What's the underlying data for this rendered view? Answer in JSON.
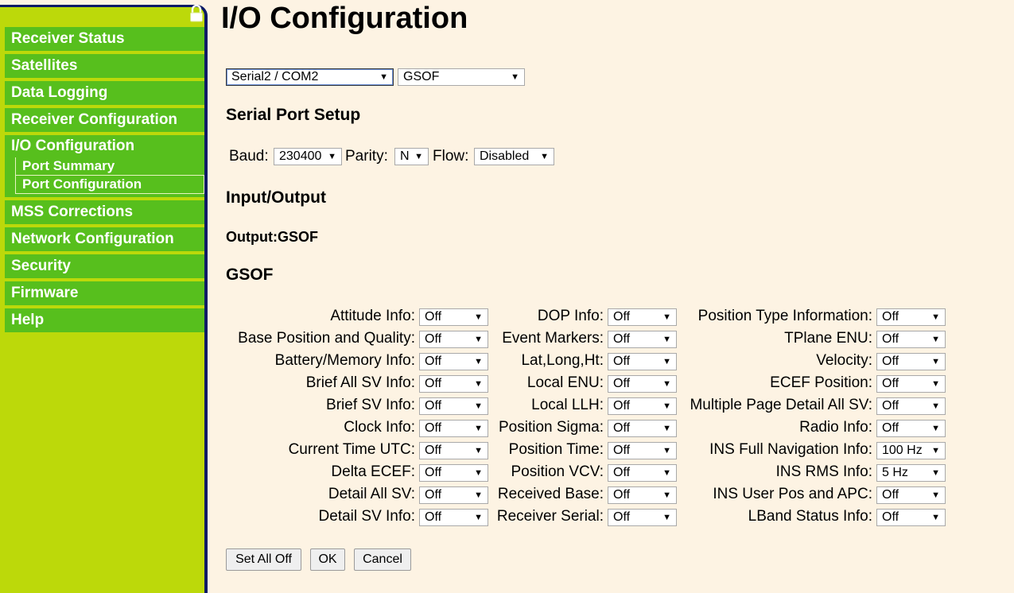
{
  "sidebar": {
    "items": [
      {
        "label": "Receiver Status"
      },
      {
        "label": "Satellites"
      },
      {
        "label": "Data Logging"
      },
      {
        "label": "Receiver Configuration"
      },
      {
        "label": "I/O Configuration",
        "sub": [
          "Port Summary",
          "Port Configuration"
        ]
      },
      {
        "label": "MSS Corrections"
      },
      {
        "label": "Network Configuration"
      },
      {
        "label": "Security"
      },
      {
        "label": "Firmware"
      },
      {
        "label": "Help"
      }
    ]
  },
  "page": {
    "title": "I/O Configuration",
    "port_select": "Serial2 / COM2",
    "protocol_select": "GSOF",
    "serial_heading": "Serial Port Setup",
    "baud_label": "Baud:",
    "baud_value": "230400",
    "parity_label": "Parity:",
    "parity_value": "N",
    "flow_label": "Flow:",
    "flow_value": "Disabled",
    "io_heading": "Input/Output",
    "output_label": "Output:GSOF",
    "gsof_heading": "GSOF",
    "buttons": {
      "set_all_off": "Set All Off",
      "ok": "OK",
      "cancel": "Cancel"
    }
  },
  "gsof": {
    "col1": [
      {
        "label": "Attitude Info:",
        "value": "Off"
      },
      {
        "label": "Base Position and Quality:",
        "value": "Off"
      },
      {
        "label": "Battery/Memory Info:",
        "value": "Off"
      },
      {
        "label": "Brief All SV Info:",
        "value": "Off"
      },
      {
        "label": "Brief SV Info:",
        "value": "Off"
      },
      {
        "label": "Clock Info:",
        "value": "Off"
      },
      {
        "label": "Current Time UTC:",
        "value": "Off"
      },
      {
        "label": "Delta ECEF:",
        "value": "Off"
      },
      {
        "label": "Detail All SV:",
        "value": "Off"
      },
      {
        "label": "Detail SV Info:",
        "value": "Off"
      }
    ],
    "col2": [
      {
        "label": "DOP Info:",
        "value": "Off"
      },
      {
        "label": "Event Markers:",
        "value": "Off"
      },
      {
        "label": "Lat,Long,Ht:",
        "value": "Off"
      },
      {
        "label": "Local ENU:",
        "value": "Off"
      },
      {
        "label": "Local LLH:",
        "value": "Off"
      },
      {
        "label": "Position Sigma:",
        "value": "Off"
      },
      {
        "label": "Position Time:",
        "value": "Off"
      },
      {
        "label": "Position VCV:",
        "value": "Off"
      },
      {
        "label": "Received Base:",
        "value": "Off"
      },
      {
        "label": "Receiver Serial:",
        "value": "Off"
      }
    ],
    "col3": [
      {
        "label": "Position Type Information:",
        "value": "Off"
      },
      {
        "label": "TPlane ENU:",
        "value": "Off"
      },
      {
        "label": "Velocity:",
        "value": "Off"
      },
      {
        "label": "ECEF Position:",
        "value": "Off"
      },
      {
        "label": "Multiple Page Detail All SV:",
        "value": "Off"
      },
      {
        "label": "Radio Info:",
        "value": "Off"
      },
      {
        "label": "INS Full Navigation Info:",
        "value": "100 Hz"
      },
      {
        "label": "INS RMS Info:",
        "value": "5 Hz"
      },
      {
        "label": "INS User Pos and APC:",
        "value": "Off"
      },
      {
        "label": "LBand Status Info:",
        "value": "Off"
      }
    ]
  }
}
